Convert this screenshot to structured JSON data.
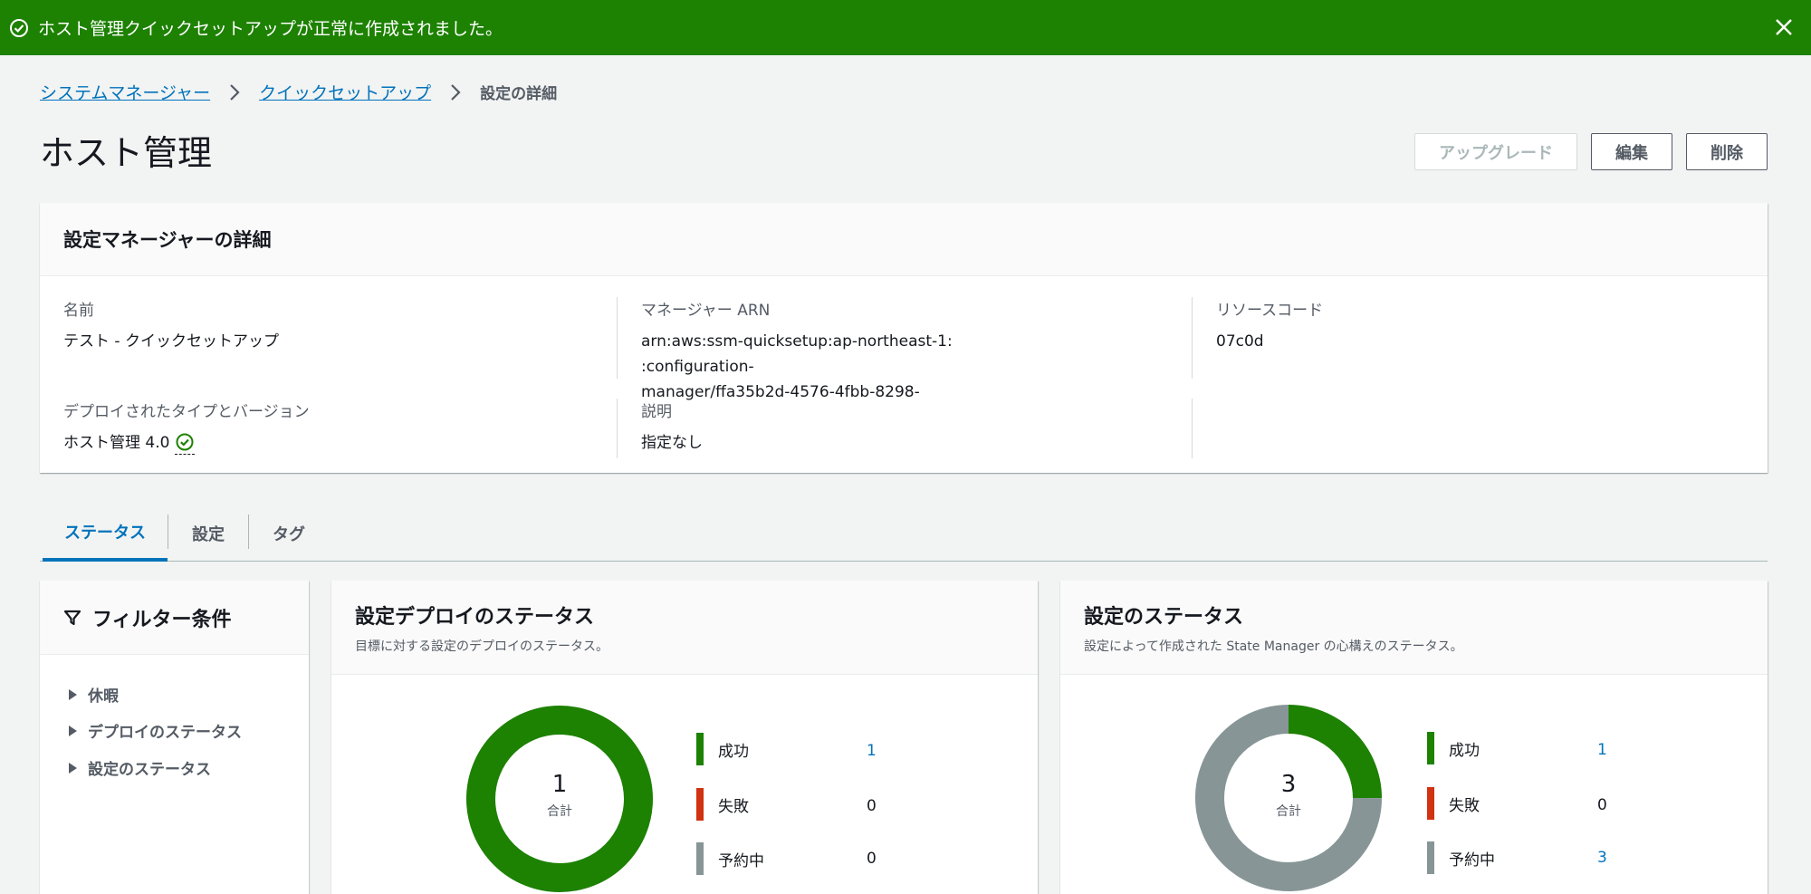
{
  "flash": {
    "message": "ホスト管理クイックセットアップが正常に作成されました。"
  },
  "breadcrumb": {
    "item1": "システムマネージャー",
    "item2": "クイックセットアップ",
    "current": "設定の詳細"
  },
  "page": {
    "title": "ホスト管理"
  },
  "actions": {
    "upgrade": "アップグレード",
    "edit": "編集",
    "delete": "削除"
  },
  "details": {
    "header": "設定マネージャーの詳細",
    "name_label": "名前",
    "name_value": "テスト - クイックセットアップ",
    "arn_label": "マネージャー ARN",
    "arn_line1a": "arn:aws:ssm-quicksetup:ap-northeast-1:",
    "arn_line1b": ":configuration-",
    "arn_line2": "manager/ffa35b2d-4576-4fbb-8298-",
    "resource_label": "リソースコード",
    "resource_value": "07c0d",
    "deployed_label": "デプロイされたタイプとバージョン",
    "deployed_value": "ホスト管理 4.0",
    "desc_label": "説明",
    "desc_value": "指定なし"
  },
  "tabs": [
    "ステータス",
    "設定",
    "タグ"
  ],
  "filter": {
    "title": "フィルター条件",
    "items": [
      "休暇",
      "デプロイのステータス",
      "設定のステータス"
    ]
  },
  "deploy_status": {
    "title": "設定デプロイのステータス",
    "subtitle": "目標に対する設定のデプロイのステータス。",
    "total": "1",
    "total_label": "合計",
    "legend": [
      {
        "label": "成功",
        "value": "1",
        "color": "#1d8102"
      },
      {
        "label": "失敗",
        "value": "0",
        "color": "#d13212"
      },
      {
        "label": "予約中",
        "value": "0",
        "color": "#879596"
      }
    ]
  },
  "config_status": {
    "title": "設定のステータス",
    "subtitle": "設定によって作成された State Manager の心構えのステータス。",
    "total": "3",
    "total_label": "合計",
    "legend": [
      {
        "label": "成功",
        "value": "1",
        "color": "#1d8102"
      },
      {
        "label": "失敗",
        "value": "0",
        "color": "#d13212"
      },
      {
        "label": "予約中",
        "value": "3",
        "color": "#879596"
      }
    ]
  },
  "colors": {
    "success": "#1d8102",
    "error": "#d13212",
    "pending": "#879596",
    "link": "#0073bb"
  }
}
